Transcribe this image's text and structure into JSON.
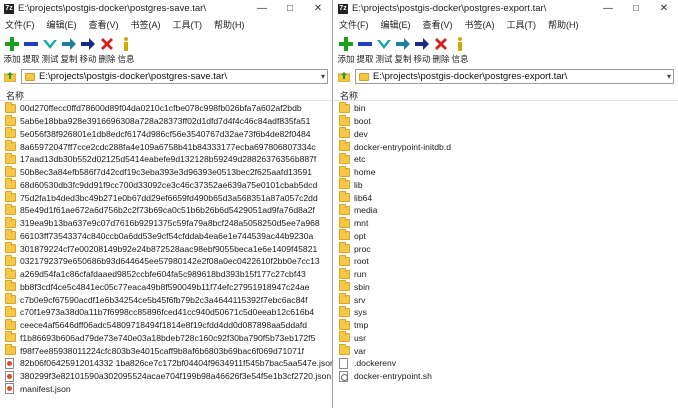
{
  "left_window": {
    "title": "E:\\projects\\postgis-docker\\postgres-save.tar\\",
    "address": "E:\\projects\\postgis-docker\\postgres-save.tar\\",
    "column_header": "名称",
    "items": [
      {
        "name": "00d270ffecc0ffd78600d89f04da0210c1cfbe078c998fb026bfa7a602af2bdb",
        "type": "folder"
      },
      {
        "name": "5ab6e18bba928e3916696308a728a28373ff02d1dfd7d4f4c46c84adf835fa51",
        "type": "folder"
      },
      {
        "name": "5e056f38f926801e1db8edcf6174d986cf56e3540767d32ae73f6b4de82f0484",
        "type": "folder"
      },
      {
        "name": "8a65972047ff7cce2cdc288fa4e109a6758b41b84333177ecba697806807334c",
        "type": "folder"
      },
      {
        "name": "17aad13db30b552d02125d5414eabefe9d132128b59249d28826376356b887f",
        "type": "folder"
      },
      {
        "name": "50b8ec3a84efb586f7d42cdf19c3eba393e3d96393e0513bec2f625aafd13591",
        "type": "folder"
      },
      {
        "name": "68d60530db3fc9dd91f9cc700d33092ce3c46c37352ae639a75e0101cbab5dcd",
        "type": "folder"
      },
      {
        "name": "75d2fa1b4ded3bc49b271e0b67dd29ef6659fd490b65d3a568351a87a057c2dd",
        "type": "folder"
      },
      {
        "name": "85e49d1f61ae672a6d756b2c2f73b69ca0c51b6b26b6d5429051ad9fa76d8a2f",
        "type": "folder"
      },
      {
        "name": "319ea9b13ba637e9c07d7616b9291375c59fa79a8bcf248a5058250d5ee7a968",
        "type": "folder"
      },
      {
        "name": "66103ff73543374c840ccb0a6dd53e9cf54cfddab4ea6e1e744539ac44b9230a",
        "type": "folder"
      },
      {
        "name": "301879224cf7e00208149b92e24b872528aac98ebf9055beca1e6e1409f45821",
        "type": "folder"
      },
      {
        "name": "0321792379e650686b93d644645ee57980142e2f08a0ec0422610f2bb0e7cc13",
        "type": "folder"
      },
      {
        "name": "a269d54fa1c86cfafdaaed9852ccbfe604fa5c989618bd393b15f177c27cbf43",
        "type": "folder"
      },
      {
        "name": "bb8f3cdf4ce5c4841ec05c77eaca49b8f590049b11f74efc27951918947c24ae",
        "type": "folder"
      },
      {
        "name": "c7b0e9cf67590acdf1e6b34254ce5b45f6fb79b2c3a4644115392f7ebc6ac84f",
        "type": "folder"
      },
      {
        "name": "c70f1e973a38d0a11b7f6998cc85896fced41cc940d50671c5d0eeab12c616b4",
        "type": "folder"
      },
      {
        "name": "ceece4af5646dff06adc54809718494f1814e8f19cfdd4dd0d087898aa5ddafd",
        "type": "folder"
      },
      {
        "name": "f1b86693b606ad79de73e740e03a18bdeb728c160c92f30ba790f5b73eb172f5",
        "type": "folder"
      },
      {
        "name": "f98f7ee85938011224cfc803b3e4015caff9b8af6b6803b69bac6f069d71071f",
        "type": "folder"
      },
      {
        "name": "82b06f06425912014332 1ba826ce7c172bf04404f9634911f545b7bac5aa547e.json",
        "type": "json"
      },
      {
        "name": "380299f3e82101590a302095524acae704f199b98a46626f3e54f5e1b3cf2720.json",
        "type": "json"
      },
      {
        "name": "manifest.json",
        "type": "json"
      }
    ]
  },
  "right_window": {
    "title": "E:\\projects\\postgis-docker\\postgres-export.tar\\",
    "address": "E:\\projects\\postgis-docker\\postgres-export.tar\\",
    "column_header": "名称",
    "items": [
      {
        "name": "bin",
        "type": "folder"
      },
      {
        "name": "boot",
        "type": "folder"
      },
      {
        "name": "dev",
        "type": "folder"
      },
      {
        "name": "docker-entrypoint-initdb.d",
        "type": "folder"
      },
      {
        "name": "etc",
        "type": "folder"
      },
      {
        "name": "home",
        "type": "folder"
      },
      {
        "name": "lib",
        "type": "folder"
      },
      {
        "name": "lib64",
        "type": "folder"
      },
      {
        "name": "media",
        "type": "folder"
      },
      {
        "name": "mnt",
        "type": "folder"
      },
      {
        "name": "opt",
        "type": "folder"
      },
      {
        "name": "proc",
        "type": "folder"
      },
      {
        "name": "root",
        "type": "folder"
      },
      {
        "name": "run",
        "type": "folder"
      },
      {
        "name": "sbin",
        "type": "folder"
      },
      {
        "name": "srv",
        "type": "folder"
      },
      {
        "name": "sys",
        "type": "folder"
      },
      {
        "name": "tmp",
        "type": "folder"
      },
      {
        "name": "usr",
        "type": "folder"
      },
      {
        "name": "var",
        "type": "folder"
      },
      {
        "name": ".dockerenv",
        "type": "file"
      },
      {
        "name": "docker-entrypoint.sh",
        "type": "gear"
      }
    ]
  },
  "menu": [
    "文件(F)",
    "编辑(E)",
    "查看(V)",
    "书签(A)",
    "工具(T)",
    "帮助(H)"
  ],
  "toolbar": [
    {
      "label": "添加",
      "icon": "plus-icon",
      "color": "#1aa31a"
    },
    {
      "label": "提取",
      "icon": "minus-icon",
      "color": "#1f3fbf"
    },
    {
      "label": "测试",
      "icon": "check-icon",
      "color": "#19a9a9"
    },
    {
      "label": "复制",
      "icon": "copy-arrow-icon",
      "color": "#1f7fa0"
    },
    {
      "label": "移动",
      "icon": "move-arrow-icon",
      "color": "#1a2a8a"
    },
    {
      "label": "删除",
      "icon": "delete-x-icon",
      "color": "#d61f1f"
    },
    {
      "label": "信息",
      "icon": "info-icon",
      "color": "#d4a800"
    }
  ],
  "window_controls": {
    "minimize": "—",
    "maximize": "□",
    "close": "✕"
  },
  "app_icon_text": "7z"
}
